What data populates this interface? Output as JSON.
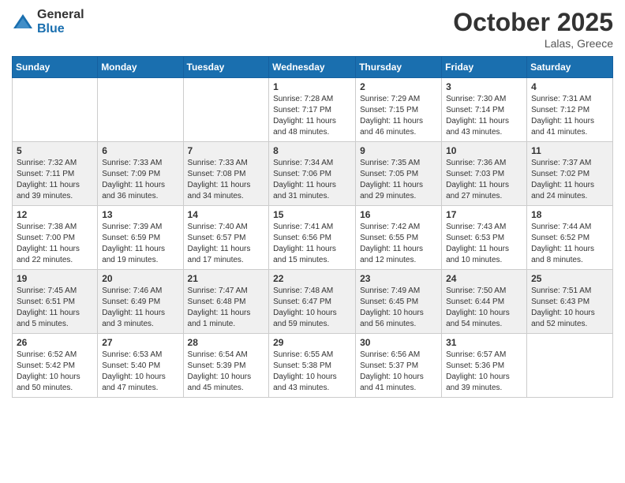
{
  "logo": {
    "general": "General",
    "blue": "Blue"
  },
  "header": {
    "month_year": "October 2025",
    "location": "Lalas, Greece"
  },
  "weekdays": [
    "Sunday",
    "Monday",
    "Tuesday",
    "Wednesday",
    "Thursday",
    "Friday",
    "Saturday"
  ],
  "weeks": [
    [
      {
        "day": "",
        "info": ""
      },
      {
        "day": "",
        "info": ""
      },
      {
        "day": "",
        "info": ""
      },
      {
        "day": "1",
        "info": "Sunrise: 7:28 AM\nSunset: 7:17 PM\nDaylight: 11 hours\nand 48 minutes."
      },
      {
        "day": "2",
        "info": "Sunrise: 7:29 AM\nSunset: 7:15 PM\nDaylight: 11 hours\nand 46 minutes."
      },
      {
        "day": "3",
        "info": "Sunrise: 7:30 AM\nSunset: 7:14 PM\nDaylight: 11 hours\nand 43 minutes."
      },
      {
        "day": "4",
        "info": "Sunrise: 7:31 AM\nSunset: 7:12 PM\nDaylight: 11 hours\nand 41 minutes."
      }
    ],
    [
      {
        "day": "5",
        "info": "Sunrise: 7:32 AM\nSunset: 7:11 PM\nDaylight: 11 hours\nand 39 minutes."
      },
      {
        "day": "6",
        "info": "Sunrise: 7:33 AM\nSunset: 7:09 PM\nDaylight: 11 hours\nand 36 minutes."
      },
      {
        "day": "7",
        "info": "Sunrise: 7:33 AM\nSunset: 7:08 PM\nDaylight: 11 hours\nand 34 minutes."
      },
      {
        "day": "8",
        "info": "Sunrise: 7:34 AM\nSunset: 7:06 PM\nDaylight: 11 hours\nand 31 minutes."
      },
      {
        "day": "9",
        "info": "Sunrise: 7:35 AM\nSunset: 7:05 PM\nDaylight: 11 hours\nand 29 minutes."
      },
      {
        "day": "10",
        "info": "Sunrise: 7:36 AM\nSunset: 7:03 PM\nDaylight: 11 hours\nand 27 minutes."
      },
      {
        "day": "11",
        "info": "Sunrise: 7:37 AM\nSunset: 7:02 PM\nDaylight: 11 hours\nand 24 minutes."
      }
    ],
    [
      {
        "day": "12",
        "info": "Sunrise: 7:38 AM\nSunset: 7:00 PM\nDaylight: 11 hours\nand 22 minutes."
      },
      {
        "day": "13",
        "info": "Sunrise: 7:39 AM\nSunset: 6:59 PM\nDaylight: 11 hours\nand 19 minutes."
      },
      {
        "day": "14",
        "info": "Sunrise: 7:40 AM\nSunset: 6:57 PM\nDaylight: 11 hours\nand 17 minutes."
      },
      {
        "day": "15",
        "info": "Sunrise: 7:41 AM\nSunset: 6:56 PM\nDaylight: 11 hours\nand 15 minutes."
      },
      {
        "day": "16",
        "info": "Sunrise: 7:42 AM\nSunset: 6:55 PM\nDaylight: 11 hours\nand 12 minutes."
      },
      {
        "day": "17",
        "info": "Sunrise: 7:43 AM\nSunset: 6:53 PM\nDaylight: 11 hours\nand 10 minutes."
      },
      {
        "day": "18",
        "info": "Sunrise: 7:44 AM\nSunset: 6:52 PM\nDaylight: 11 hours\nand 8 minutes."
      }
    ],
    [
      {
        "day": "19",
        "info": "Sunrise: 7:45 AM\nSunset: 6:51 PM\nDaylight: 11 hours\nand 5 minutes."
      },
      {
        "day": "20",
        "info": "Sunrise: 7:46 AM\nSunset: 6:49 PM\nDaylight: 11 hours\nand 3 minutes."
      },
      {
        "day": "21",
        "info": "Sunrise: 7:47 AM\nSunset: 6:48 PM\nDaylight: 11 hours\nand 1 minute."
      },
      {
        "day": "22",
        "info": "Sunrise: 7:48 AM\nSunset: 6:47 PM\nDaylight: 10 hours\nand 59 minutes."
      },
      {
        "day": "23",
        "info": "Sunrise: 7:49 AM\nSunset: 6:45 PM\nDaylight: 10 hours\nand 56 minutes."
      },
      {
        "day": "24",
        "info": "Sunrise: 7:50 AM\nSunset: 6:44 PM\nDaylight: 10 hours\nand 54 minutes."
      },
      {
        "day": "25",
        "info": "Sunrise: 7:51 AM\nSunset: 6:43 PM\nDaylight: 10 hours\nand 52 minutes."
      }
    ],
    [
      {
        "day": "26",
        "info": "Sunrise: 6:52 AM\nSunset: 5:42 PM\nDaylight: 10 hours\nand 50 minutes."
      },
      {
        "day": "27",
        "info": "Sunrise: 6:53 AM\nSunset: 5:40 PM\nDaylight: 10 hours\nand 47 minutes."
      },
      {
        "day": "28",
        "info": "Sunrise: 6:54 AM\nSunset: 5:39 PM\nDaylight: 10 hours\nand 45 minutes."
      },
      {
        "day": "29",
        "info": "Sunrise: 6:55 AM\nSunset: 5:38 PM\nDaylight: 10 hours\nand 43 minutes."
      },
      {
        "day": "30",
        "info": "Sunrise: 6:56 AM\nSunset: 5:37 PM\nDaylight: 10 hours\nand 41 minutes."
      },
      {
        "day": "31",
        "info": "Sunrise: 6:57 AM\nSunset: 5:36 PM\nDaylight: 10 hours\nand 39 minutes."
      },
      {
        "day": "",
        "info": ""
      }
    ]
  ]
}
